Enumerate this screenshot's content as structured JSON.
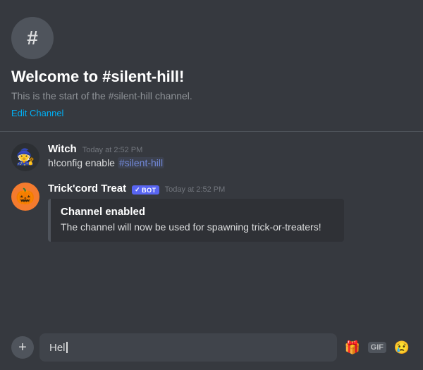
{
  "channel": {
    "name": "#silent-hill",
    "title": "Welcome to #silent-hill!",
    "description": "This is the start of the #silent-hill channel.",
    "edit_label": "Edit Channel",
    "icon_symbol": "#"
  },
  "messages": [
    {
      "id": "msg1",
      "username": "Witch",
      "avatar_emoji": "🧙",
      "timestamp": "Today at 2:52 PM",
      "text_prefix": "h!config enable ",
      "mention": "#silent-hill",
      "is_bot": false
    },
    {
      "id": "msg2",
      "username": "Trick'cord Treat",
      "avatar_emoji": "🎃",
      "timestamp": "Today at 2:52 PM",
      "text": "",
      "is_bot": true,
      "bot_label": "BOT",
      "embed": {
        "title": "Channel enabled",
        "description": "The channel will now be used for spawning trick-or-treaters!"
      }
    }
  ],
  "input": {
    "placeholder": "Hel",
    "plus_label": "+",
    "gift_icon": "🎁",
    "gif_label": "GIF",
    "emoji_icon": "😢"
  }
}
